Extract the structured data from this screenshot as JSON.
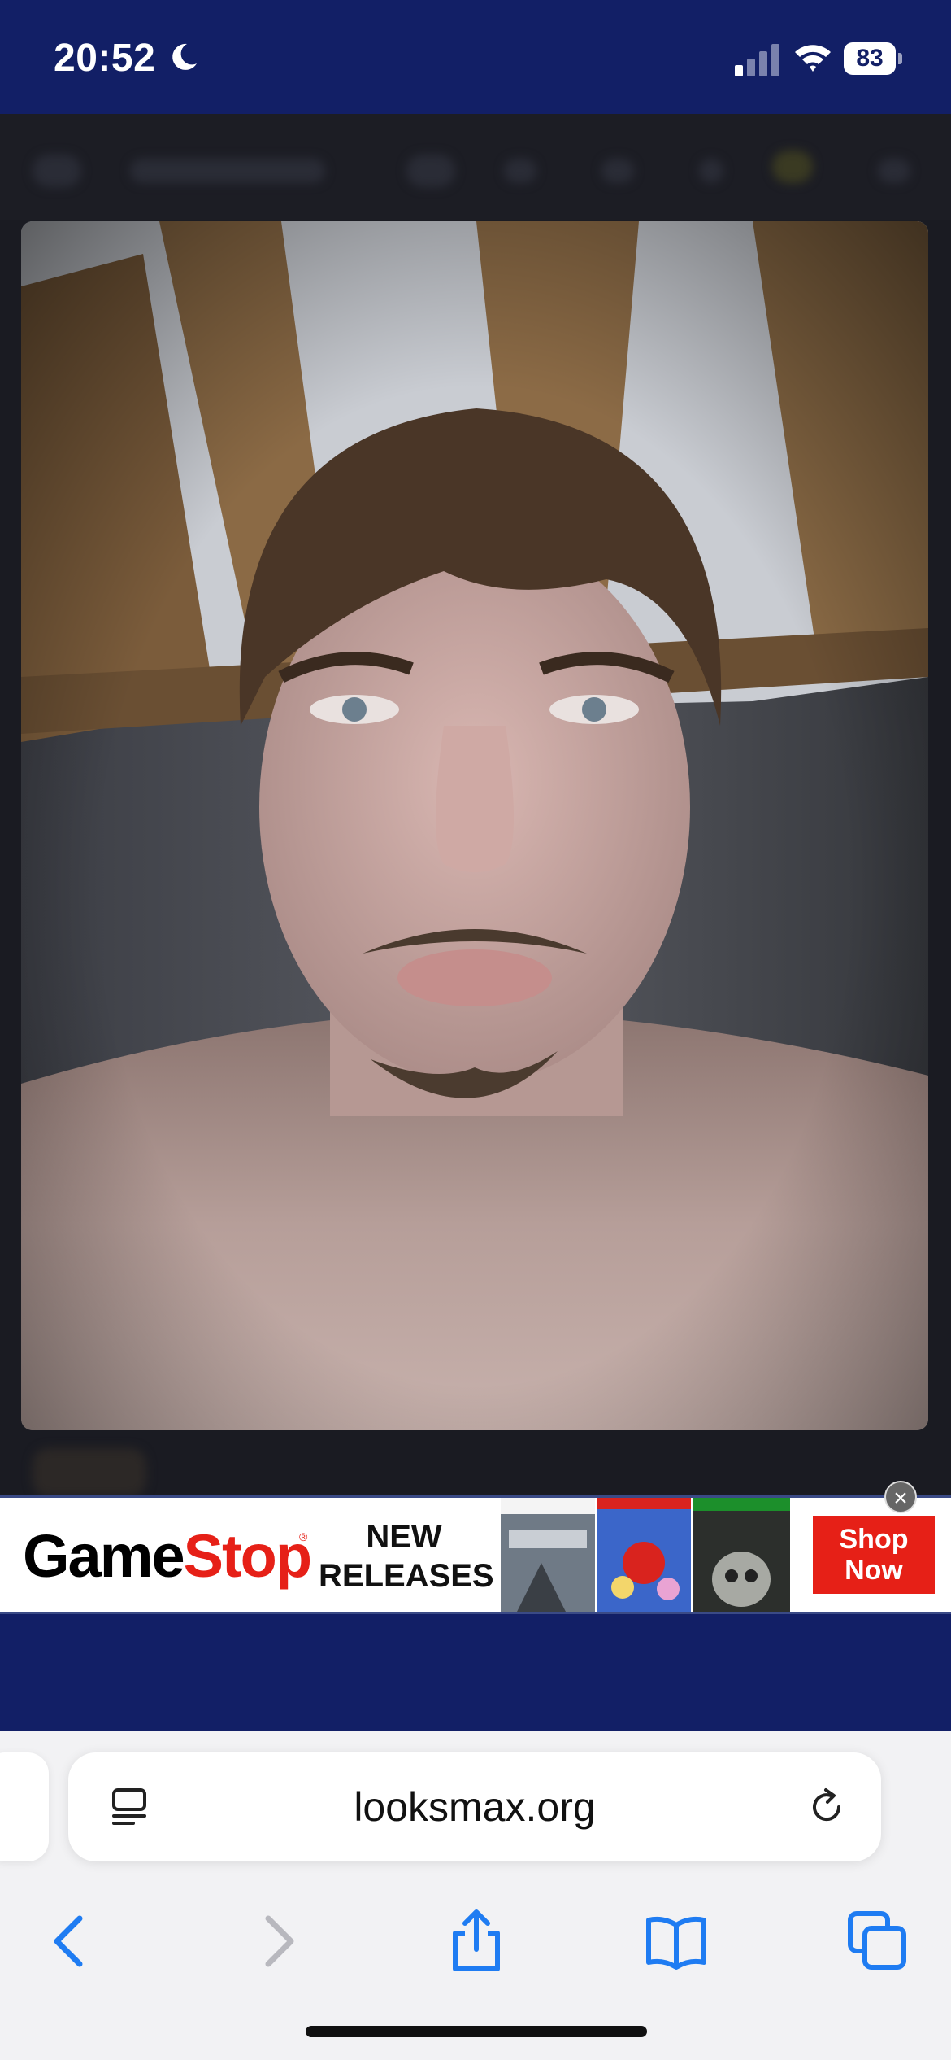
{
  "status_bar": {
    "time": "20:52",
    "battery": "83",
    "icons": [
      "moon-icon",
      "signal-icon",
      "wifi-icon",
      "battery-icon"
    ]
  },
  "ad": {
    "brand_a": "Game",
    "brand_b": "Stop",
    "registered": "®",
    "headline_line1": "NEW",
    "headline_line2": "RELEASES",
    "cta_line1": "Shop",
    "cta_line2": "Now",
    "close": "×",
    "colors": {
      "brand_red": "#e62017",
      "border": "#3a4a86"
    }
  },
  "browser": {
    "url": "looksmax.org",
    "nav_icons": [
      "back-icon",
      "forward-icon",
      "share-icon",
      "bookmarks-icon",
      "tabs-icon"
    ]
  },
  "colors": {
    "site_navy": "#121f66",
    "accent_blue": "#1f7cf2"
  }
}
